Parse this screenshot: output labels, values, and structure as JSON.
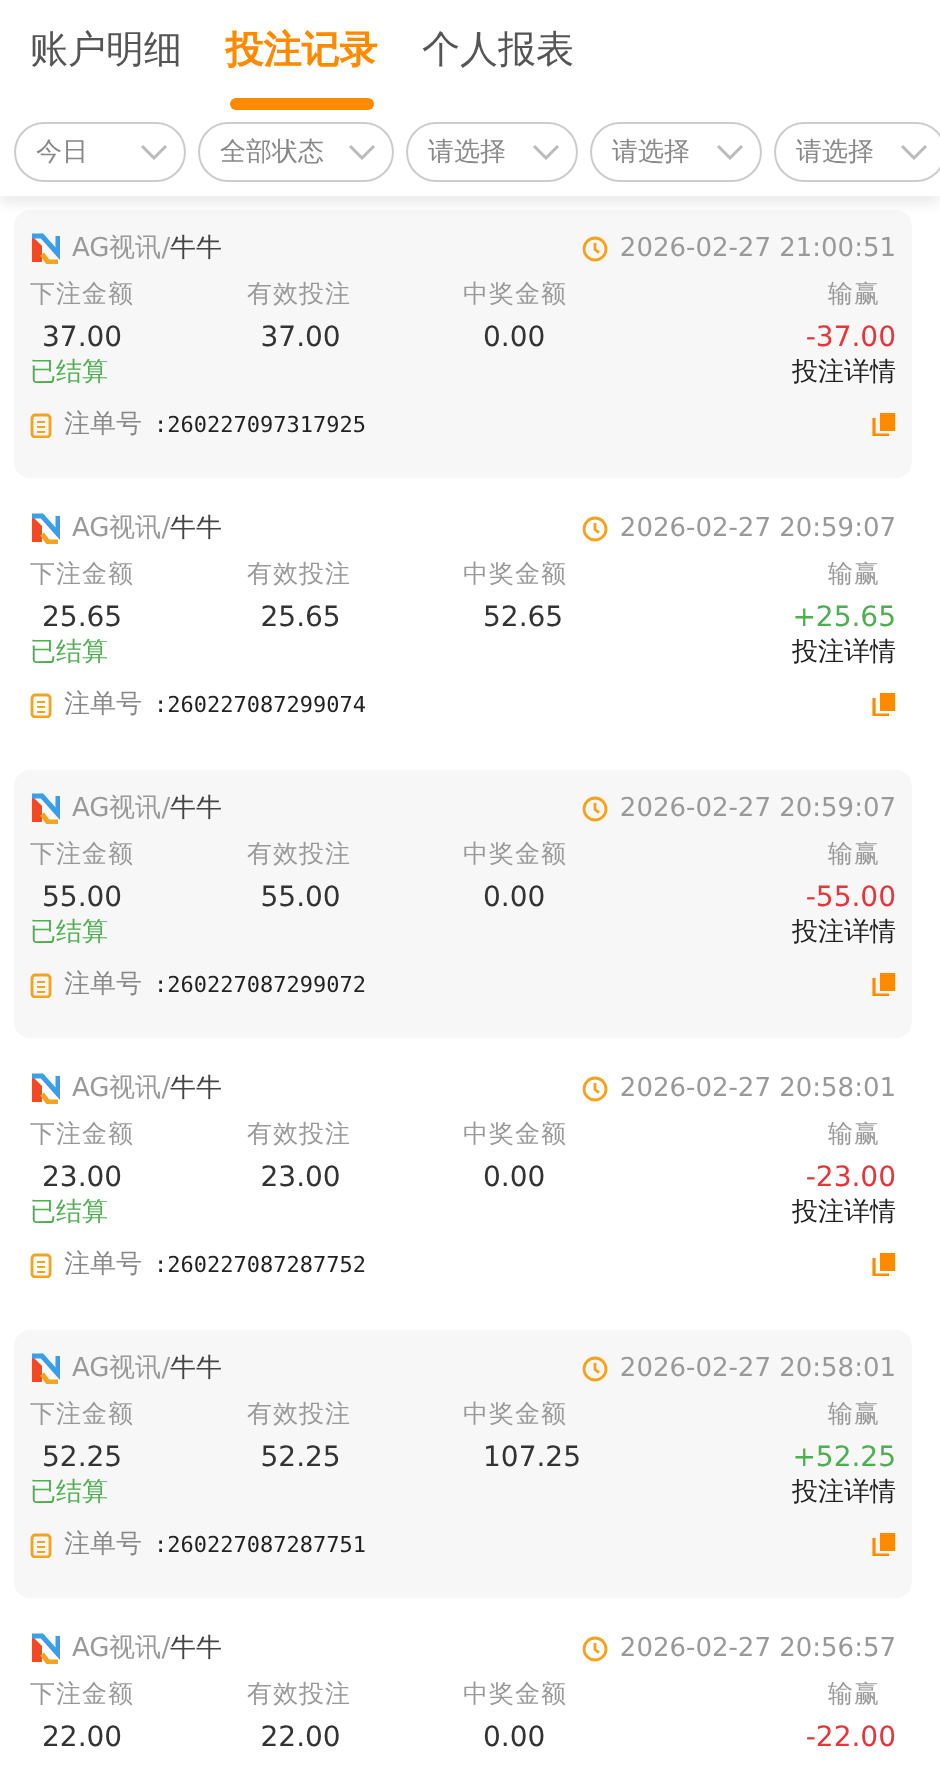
{
  "tabs": [
    {
      "label": "账户明细",
      "selected": false
    },
    {
      "label": "投注记录",
      "selected": true
    },
    {
      "label": "个人报表",
      "selected": false
    }
  ],
  "filters": [
    {
      "label": "今日"
    },
    {
      "label": "全部状态"
    },
    {
      "label": "请选择"
    },
    {
      "label": "请选择"
    },
    {
      "label": "请选择"
    }
  ],
  "records": [
    {
      "platform": "AG视讯",
      "separator": "/",
      "game": "牛牛",
      "time": "2026-02-27 21:00:51",
      "labels": [
        "下注金额",
        "有效投注",
        "中奖金额",
        "输赢"
      ],
      "bet": "37.00",
      "valid": "37.00",
      "payout": "0.00",
      "result": {
        "text": "-37.00",
        "color": "#e8353a"
      },
      "status": "已结算",
      "detail": "投注详情",
      "order_label": "注单号",
      "order_no": ":260227097317925"
    },
    {
      "platform": "AG视讯",
      "separator": "/",
      "game": "牛牛",
      "time": "2026-02-27 20:59:07",
      "labels": [
        "下注金额",
        "有效投注",
        "中奖金额",
        "输赢"
      ],
      "bet": "25.65",
      "valid": "25.65",
      "payout": "52.65",
      "result": {
        "text": "+25.65",
        "color": "#4caf50"
      },
      "status": "已结算",
      "detail": "投注详情",
      "order_label": "注单号",
      "order_no": ":260227087299074"
    },
    {
      "platform": "AG视讯",
      "separator": "/",
      "game": "牛牛",
      "time": "2026-02-27 20:59:07",
      "labels": [
        "下注金额",
        "有效投注",
        "中奖金额",
        "输赢"
      ],
      "bet": "55.00",
      "valid": "55.00",
      "payout": "0.00",
      "result": {
        "text": "-55.00",
        "color": "#e8353a"
      },
      "status": "已结算",
      "detail": "投注详情",
      "order_label": "注单号",
      "order_no": ":260227087299072"
    },
    {
      "platform": "AG视讯",
      "separator": "/",
      "game": "牛牛",
      "time": "2026-02-27 20:58:01",
      "labels": [
        "下注金额",
        "有效投注",
        "中奖金额",
        "输赢"
      ],
      "bet": "23.00",
      "valid": "23.00",
      "payout": "0.00",
      "result": {
        "text": "-23.00",
        "color": "#e8353a"
      },
      "status": "已结算",
      "detail": "投注详情",
      "order_label": "注单号",
      "order_no": ":260227087287752"
    },
    {
      "platform": "AG视讯",
      "separator": "/",
      "game": "牛牛",
      "time": "2026-02-27 20:58:01",
      "labels": [
        "下注金额",
        "有效投注",
        "中奖金额",
        "输赢"
      ],
      "bet": "52.25",
      "valid": "52.25",
      "payout": "107.25",
      "result": {
        "text": "+52.25",
        "color": "#4caf50"
      },
      "status": "已结算",
      "detail": "投注详情",
      "order_label": "注单号",
      "order_no": ":260227087287751"
    },
    {
      "platform": "AG视讯",
      "separator": "/",
      "game": "牛牛",
      "time": "2026-02-27 20:56:57",
      "labels": [
        "下注金额",
        "有效投注",
        "中奖金额",
        "输赢"
      ],
      "bet": "22.00",
      "valid": "22.00",
      "payout": "0.00",
      "result": {
        "text": "-22.00",
        "color": "#e8353a"
      }
    }
  ]
}
